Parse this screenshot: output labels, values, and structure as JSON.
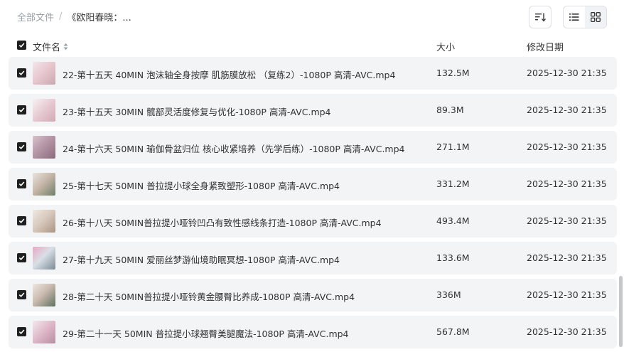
{
  "breadcrumb": {
    "root": "全部文件",
    "separator": "/",
    "current": "《欧阳春晓：..."
  },
  "toolbar": {
    "sort_icon": "sort-lines-icon",
    "list_view_icon": "list-view-icon",
    "grid_view_icon": "grid-view-icon",
    "active_view": "list"
  },
  "table": {
    "header": {
      "name": "文件名",
      "size": "大小",
      "date": "修改日期"
    },
    "rows": [
      {
        "name": "22-第十五天 40MIN 泡沫轴全身按摩 肌筋膜放松 （复练2）-1080P 高清-AVC.mp4",
        "size": "132.5M",
        "date": "2025-12-30 21:35",
        "checked": true
      },
      {
        "name": "23-第十五天 30MIN 髋部灵活度修复与优化-1080P 高清-AVC.mp4",
        "size": "89.3M",
        "date": "2025-12-30 21:35",
        "checked": true
      },
      {
        "name": "24-第十六天 50MIN 瑜伽骨盆归位 核心收紧培养（先学后练）-1080P 高清-AVC.mp4",
        "size": "271.1M",
        "date": "2025-12-30 21:35",
        "checked": true
      },
      {
        "name": "25-第十七天 50MIN 普拉提小球全身紧致塑形-1080P 高清-AVC.mp4",
        "size": "331.2M",
        "date": "2025-12-30 21:35",
        "checked": true
      },
      {
        "name": "26-第十八天 50MIN普拉提小哑铃凹凸有致性感线条打造-1080P 高清-AVC.mp4",
        "size": "493.4M",
        "date": "2025-12-30 21:35",
        "checked": true
      },
      {
        "name": "27-第十九天 50MIN 爱丽丝梦游仙境助眠冥想-1080P 高清-AVC.mp4",
        "size": "133.6M",
        "date": "2025-12-30 21:35",
        "checked": true
      },
      {
        "name": "28-第二十天 50MIN普拉提小哑铃黄金腰臀比养成-1080P 高清-AVC.mp4",
        "size": "336M",
        "date": "2025-12-30 21:35",
        "checked": true
      },
      {
        "name": "29-第二十一天 50MIN 普拉提小球翘臀美腿魔法-1080P 高清-AVC.mp4",
        "size": "567.8M",
        "date": "2025-12-30 21:35",
        "checked": true
      }
    ]
  },
  "colors": {
    "row_background": "#f3f4f6",
    "checkbox": "#1f1f1f",
    "muted_text": "#9aa0a8"
  }
}
